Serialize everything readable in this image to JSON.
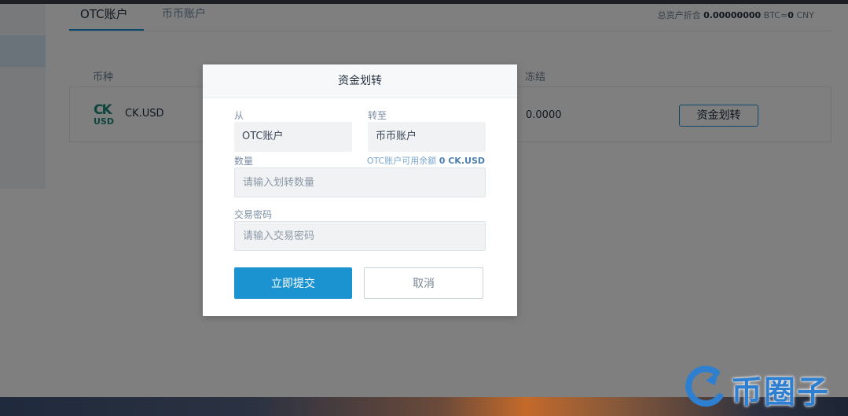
{
  "tabs": {
    "otc": "OTC账户",
    "coin": "币币账户"
  },
  "total_assets": {
    "label": "总资产折合",
    "btc_value": "0.00000000",
    "btc_unit": "BTC≈",
    "cny_value": "0",
    "cny_unit": "CNY"
  },
  "table": {
    "headers": {
      "coin": "币种",
      "frozen": "冻结"
    },
    "rows": [
      {
        "logo_top": "CK",
        "logo_bottom": "USD",
        "coin": "CK.USD",
        "frozen": "0.0000",
        "action": "资金划转"
      }
    ]
  },
  "modal": {
    "title": "资金划转",
    "from_label": "从",
    "from_value": "OTC账户",
    "to_label": "转至",
    "to_value": "币币账户",
    "amount_label": "数量",
    "balance_prefix": "OTC账户可用余额",
    "balance_value": "0 CK.USD",
    "amount_placeholder": "请输入划转数量",
    "password_label": "交易密码",
    "password_placeholder": "请输入交易密码",
    "submit_label": "立即提交",
    "cancel_label": "取消"
  },
  "watermark": {
    "text": "币圈子"
  },
  "colors": {
    "accent": "#1a93d0",
    "logo_green": "#1f8a7a",
    "watermark_blue": "#2f7fd0"
  }
}
